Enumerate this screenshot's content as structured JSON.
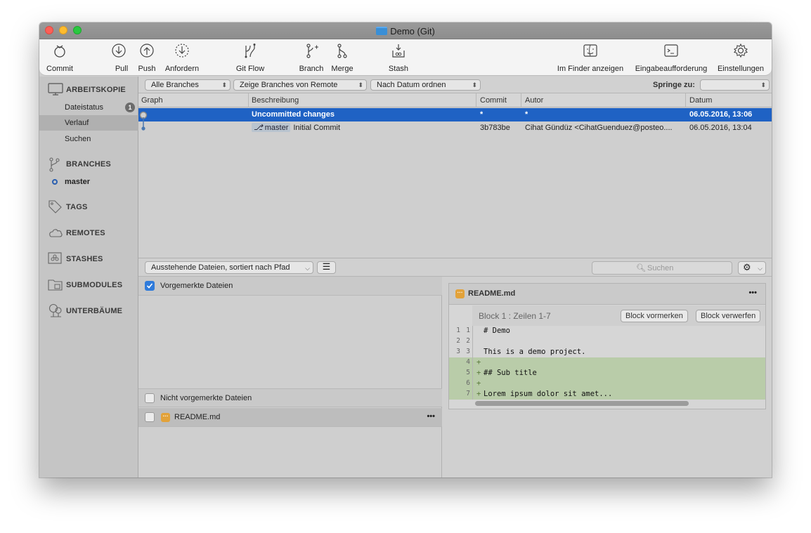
{
  "window": {
    "title": "Demo (Git)"
  },
  "toolbar": {
    "commit": "Commit",
    "pull": "Pull",
    "push": "Push",
    "fetch": "Anfordern",
    "gitflow": "Git Flow",
    "branch": "Branch",
    "merge": "Merge",
    "stash": "Stash",
    "finder": "Im Finder anzeigen",
    "terminal": "Eingabeaufforderung",
    "settings": "Einstellungen"
  },
  "sidebar": {
    "workspace": "ARBEITSKOPIE",
    "file_status": "Dateistatus",
    "file_status_count": "1",
    "history": "Verlauf",
    "search": "Suchen",
    "branches": "BRANCHES",
    "master": "master",
    "tags": "TAGS",
    "remotes": "REMOTES",
    "stashes": "STASHES",
    "submodules": "SUBMODULES",
    "subtrees": "UNTERBÄUME"
  },
  "filterbar": {
    "branches": "Alle Branches",
    "remote": "Zeige Branches von Remote",
    "order": "Nach Datum ordnen",
    "jump_to": "Springe zu:"
  },
  "commits": {
    "columns": {
      "graph": "Graph",
      "description": "Beschreibung",
      "commit": "Commit",
      "author": "Autor",
      "date": "Datum"
    },
    "rows": [
      {
        "description": "Uncommitted changes",
        "commit": "*",
        "author": "*",
        "date": "06.05.2016, 13:06"
      },
      {
        "branch": "master",
        "description": "Initial Commit",
        "commit": "3b783be",
        "author": "Cihat Gündüz <CihatGuenduez@posteo....",
        "date": "06.05.2016, 13:04"
      }
    ]
  },
  "midbar": {
    "sort": "Ausstehende Dateien, sortiert nach Pfad",
    "search_placeholder": "Suchen"
  },
  "files": {
    "staged": "Vorgemerkte Dateien",
    "unstaged": "Nicht vorgemerkte Dateien",
    "unstaged_file": "README.md",
    "more": "•••"
  },
  "diff": {
    "file": "README.md",
    "more": "•••",
    "hunk": "Block 1 : Zeilen 1-7",
    "stage_hunk": "Block vormerken",
    "discard_hunk": "Block verwerfen",
    "lines": [
      {
        "old": "1",
        "new": "1",
        "text": "# Demo",
        "add": false
      },
      {
        "old": "2",
        "new": "2",
        "text": "",
        "add": false
      },
      {
        "old": "3",
        "new": "3",
        "text": "This is a demo project.",
        "add": false
      },
      {
        "old": "",
        "new": "4",
        "text": "",
        "add": true
      },
      {
        "old": "",
        "new": "5",
        "text": "## Sub title",
        "add": true
      },
      {
        "old": "",
        "new": "6",
        "text": "",
        "add": true
      },
      {
        "old": "",
        "new": "7",
        "text": "Lorem ipsum dolor sit amet...",
        "add": true
      }
    ]
  },
  "colors": {
    "selection": "#1f62c4",
    "added_line": "#b9cca9",
    "folder": "#3a8fd6"
  }
}
